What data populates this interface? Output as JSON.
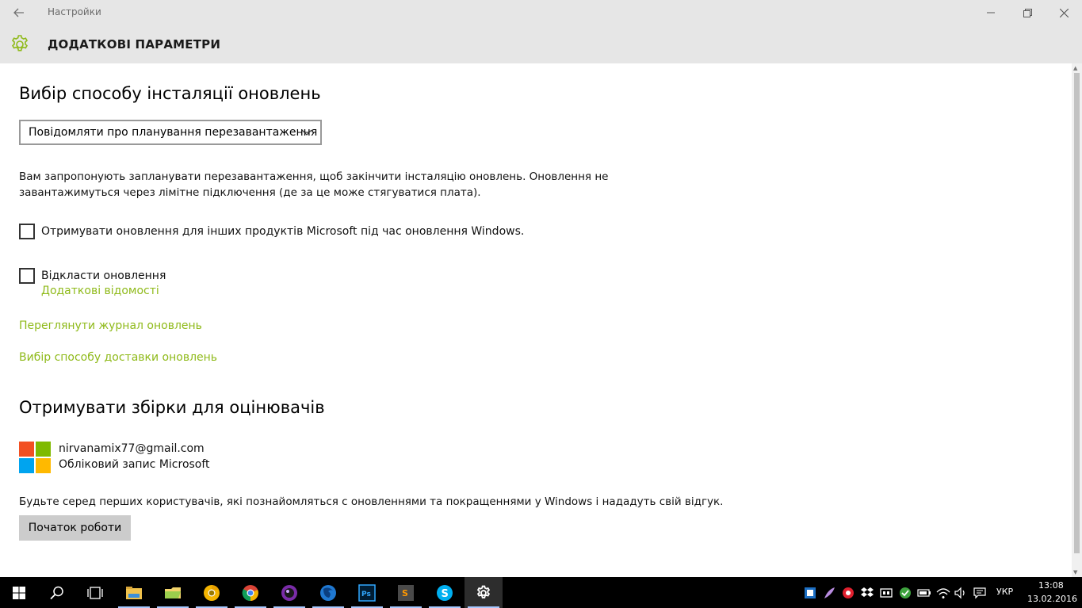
{
  "window": {
    "title": "Настройки",
    "controls": [
      "minimize",
      "restore",
      "close"
    ]
  },
  "header": {
    "icon": "gear-icon",
    "title": "ДОДАТКОВІ ПАРАМЕТРИ"
  },
  "install_section": {
    "heading": "Вибір способу інсталяції оновлень",
    "dropdown_value": "Повідомляти про планування перезавантаження",
    "description_line1": "Вам запропонують запланувати перезавантаження, щоб закінчити інсталяцію оновлень. Оновлення не",
    "description_line2": "завантажимуться через лімітне підключення (де за це може стягуватися плата).",
    "checkbox_other_products": "Отримувати оновлення для інших продуктів Microsoft під час оновлення Windows.",
    "checkbox_defer": "Відкласти оновлення",
    "link_more_info": "Додаткові відомості",
    "link_history": "Переглянути журнал оновлень",
    "link_delivery": "Вибір способу доставки оновлень"
  },
  "insider_section": {
    "heading": "Отримувати збірки для оцінювачів",
    "account_email": "nirvanamix77@gmail.com",
    "account_type": "Обліковий запис Microsoft",
    "description": "Будьте серед перших користувачів, які познайомляться с оновленнями та покращеннями у Windows і нададуть свій відгук.",
    "button_label": "Початок роботи"
  },
  "colors": {
    "accent": "#8fba1a",
    "header_bg": "#e6e6e6",
    "taskbar_bg": "#000000",
    "ms_red": "#f25022",
    "ms_green": "#7fba00",
    "ms_blue": "#00a4ef",
    "ms_yellow": "#ffb900"
  },
  "taskbar": {
    "apps": [
      "start-icon",
      "search-icon",
      "task-view-icon",
      "file-explorer-icon",
      "folder-icon",
      "chrome-canary-icon",
      "chrome-icon",
      "media-player-icon",
      "firefox-developer-icon",
      "photoshop-icon",
      "sublime-text-icon",
      "skype-icon",
      "settings-icon"
    ],
    "language": "УКР",
    "time": "13:08",
    "date": "13.02.2016"
  }
}
